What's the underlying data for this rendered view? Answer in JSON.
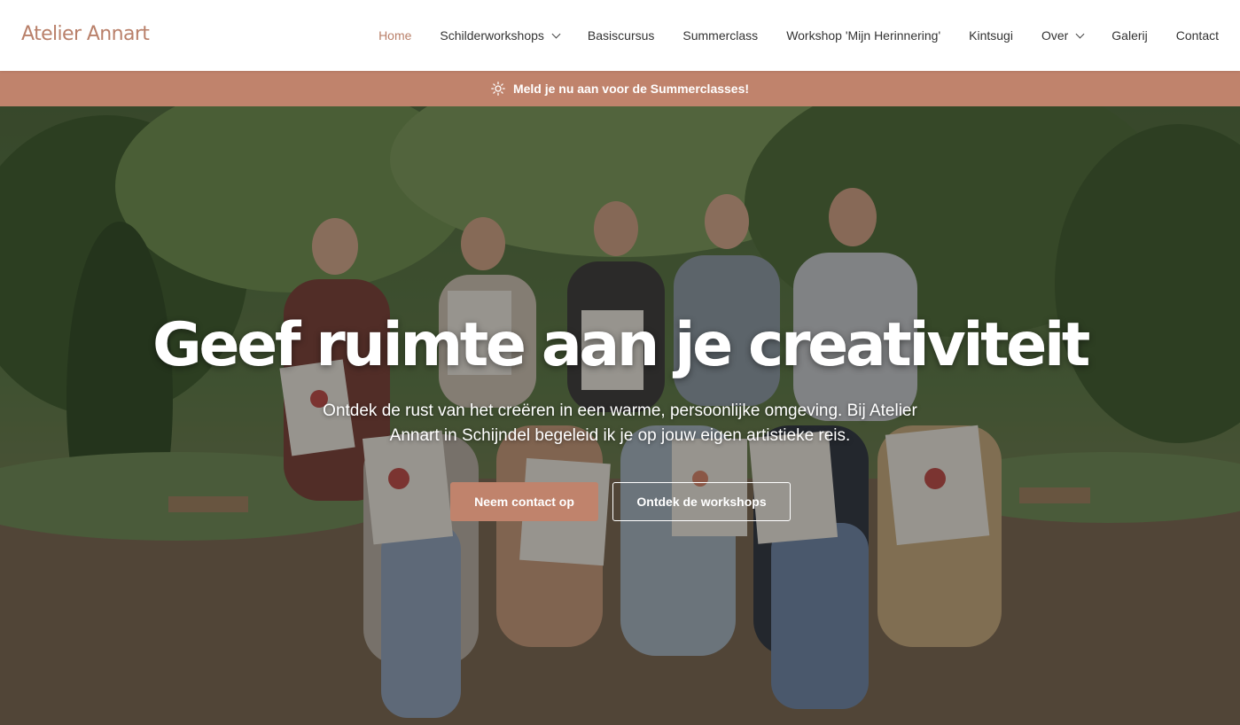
{
  "brand": {
    "name": "Atelier Annart",
    "accent_color": "#c0836c"
  },
  "nav": {
    "items": [
      {
        "label": "Home",
        "active": true,
        "dropdown": false
      },
      {
        "label": "Schilderworkshops",
        "active": false,
        "dropdown": true
      },
      {
        "label": "Basiscursus",
        "active": false,
        "dropdown": false
      },
      {
        "label": "Summerclass",
        "active": false,
        "dropdown": false
      },
      {
        "label": "Workshop 'Mijn Herinnering'",
        "active": false,
        "dropdown": false
      },
      {
        "label": "Kintsugi",
        "active": false,
        "dropdown": false
      },
      {
        "label": "Over",
        "active": false,
        "dropdown": true
      },
      {
        "label": "Galerij",
        "active": false,
        "dropdown": false
      },
      {
        "label": "Contact",
        "active": false,
        "dropdown": false
      }
    ]
  },
  "banner": {
    "icon": "sun-icon",
    "text": "Meld je nu aan voor de Summerclasses!"
  },
  "hero": {
    "title": "Geef ruimte aan je creativiteit",
    "subtitle": "Ontdek de rust van het creëren in een warme, persoonlijke omgeving. Bij Atelier Annart in Schijndel begeleid ik je op jouw eigen artistieke reis.",
    "primary_button": "Neem contact op",
    "secondary_button": "Ontdek de workshops"
  }
}
